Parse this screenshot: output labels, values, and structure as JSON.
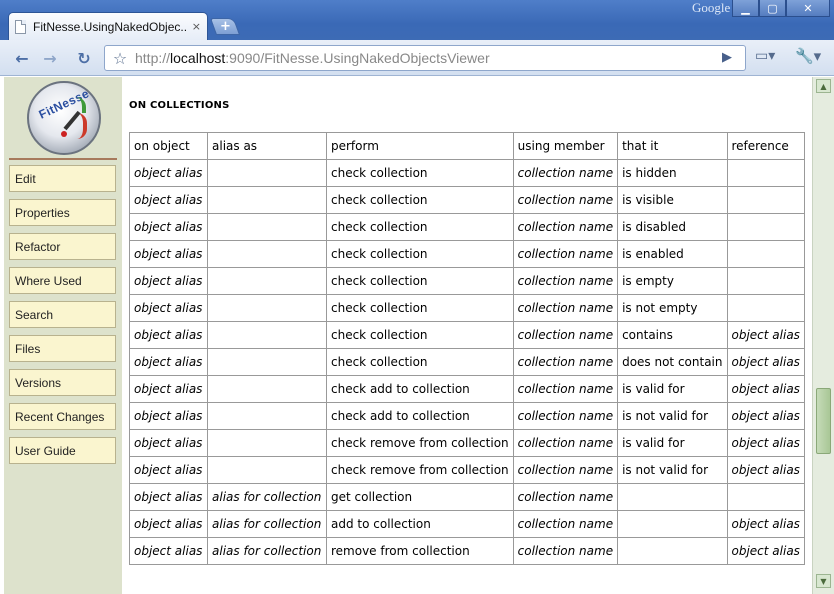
{
  "browser": {
    "tab_title": "FitNesse.UsingNakedObjec...",
    "tab_close": "×",
    "new_tab": "+",
    "brand": "Google",
    "window_buttons": {
      "minimize": "▁",
      "maximize": "▢",
      "close": "✕"
    },
    "url_prefix": "http://",
    "url_host": "localhost",
    "url_rest": ":9090/FitNesse.UsingNakedObjectsViewer",
    "back_icon": "←",
    "forward_icon": "→",
    "reload_icon": "↻",
    "star_icon": "☆",
    "go_icon": "▶",
    "page_icon": "▭▾",
    "wrench_icon": "🔧▾"
  },
  "sidebar": {
    "logo_text": "FitNesse",
    "buttons": [
      "Edit",
      "Properties",
      "Refactor",
      "Where Used",
      "Search",
      "Files",
      "Versions",
      "Recent Changes",
      "User Guide"
    ]
  },
  "main": {
    "heading": "ON COLLECTIONS",
    "table": {
      "headers": [
        "on object",
        "alias as",
        "perform",
        "using member",
        "that it",
        "reference"
      ],
      "rows": [
        [
          "object alias",
          "",
          "check collection",
          "collection name",
          "is hidden",
          ""
        ],
        [
          "object alias",
          "",
          "check collection",
          "collection name",
          "is visible",
          ""
        ],
        [
          "object alias",
          "",
          "check collection",
          "collection name",
          "is disabled",
          ""
        ],
        [
          "object alias",
          "",
          "check collection",
          "collection name",
          "is enabled",
          ""
        ],
        [
          "object alias",
          "",
          "check collection",
          "collection name",
          "is empty",
          ""
        ],
        [
          "object alias",
          "",
          "check collection",
          "collection name",
          "is not empty",
          ""
        ],
        [
          "object alias",
          "",
          "check collection",
          "collection name",
          "contains",
          "object alias"
        ],
        [
          "object alias",
          "",
          "check collection",
          "collection name",
          "does not contain",
          "object alias"
        ],
        [
          "object alias",
          "",
          "check add to collection",
          "collection name",
          "is valid for",
          "object alias"
        ],
        [
          "object alias",
          "",
          "check add to collection",
          "collection name",
          "is not valid for",
          "object alias"
        ],
        [
          "object alias",
          "",
          "check remove from collection",
          "collection name",
          "is valid for",
          "object alias"
        ],
        [
          "object alias",
          "",
          "check remove from collection",
          "collection name",
          "is not valid for",
          "object alias"
        ],
        [
          "object alias",
          "alias for collection",
          "get collection",
          "collection name",
          "",
          ""
        ],
        [
          "object alias",
          "alias for collection",
          "add to collection",
          "collection name",
          "",
          "object alias"
        ],
        [
          "object alias",
          "alias for collection",
          "remove from collection",
          "collection name",
          "",
          "object alias"
        ]
      ]
    }
  },
  "scrollbar": {
    "up": "▲",
    "down": "▼",
    "position": 0.72
  }
}
